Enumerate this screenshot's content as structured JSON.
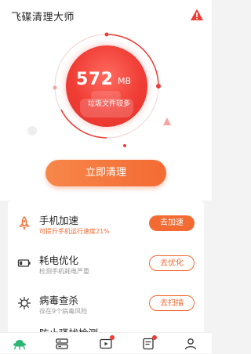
{
  "app": {
    "title": "飞碟清理大师"
  },
  "hero": {
    "junk_size": "572",
    "junk_unit": "MB",
    "junk_caption": "垃圾文件较多",
    "clean_button": "立即清理"
  },
  "features": [
    {
      "title": "手机加速",
      "desc": "可提升手机运行速度21%",
      "action": "去加速",
      "icon": "rocket-icon",
      "highlight": true,
      "style": "filled"
    },
    {
      "title": "耗电优化",
      "desc": "检测手机耗电严重",
      "action": "去优化",
      "icon": "battery-icon",
      "highlight": false,
      "style": "outline"
    },
    {
      "title": "病毒查杀",
      "desc": "存在9个病毒风险",
      "action": "去扫描",
      "icon": "virus-icon",
      "highlight": false,
      "style": "outline"
    },
    {
      "title": "防止骚扰检测",
      "desc": "",
      "action": "",
      "icon": "shield-icon",
      "highlight": false,
      "style": "outline"
    }
  ],
  "nav": [
    {
      "icon": "ufo-icon",
      "active": true
    },
    {
      "icon": "storage-icon",
      "active": false
    },
    {
      "icon": "video-icon",
      "active": false,
      "badge": true
    },
    {
      "icon": "notes-icon",
      "active": false,
      "badge": true
    },
    {
      "icon": "user-icon",
      "active": false
    }
  ],
  "colors": {
    "accent": "#f36b33",
    "red": "#ef3c34",
    "muted": "#999999"
  }
}
